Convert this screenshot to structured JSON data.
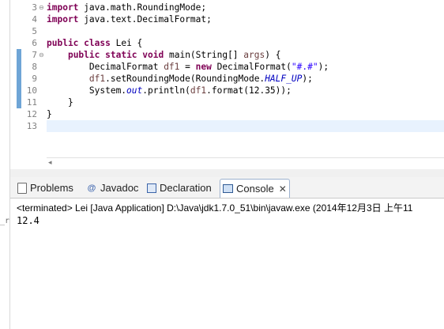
{
  "left_strip": {
    "fragment": "_r"
  },
  "editor": {
    "lines": [
      {
        "n": "3",
        "fold": "⊖"
      },
      {
        "n": "4"
      },
      {
        "n": "5"
      },
      {
        "n": "6"
      },
      {
        "n": "7",
        "fold": "⊖"
      },
      {
        "n": "8"
      },
      {
        "n": "9"
      },
      {
        "n": "10"
      },
      {
        "n": "11"
      },
      {
        "n": "12"
      },
      {
        "n": "13"
      }
    ],
    "code": {
      "l3_kw": "import",
      "l3_rest": " java.math.RoundingMode;",
      "l4_kw": "import",
      "l4_rest": " java.text.DecimalFormat;",
      "l6_kw1": "public",
      "l6_kw2": "class",
      "l6_rest": " Lei {",
      "l7_kw1": "public",
      "l7_kw2": "static",
      "l7_kw3": "void",
      "l7_mid": " main(String[] ",
      "l7_var": "args",
      "l7_end": ") {",
      "l8_a": "DecimalFormat ",
      "l8_var": "df1",
      "l8_b": " = ",
      "l8_kw": "new",
      "l8_c": " DecimalFormat(",
      "l8_str": "\"#.#\"",
      "l8_d": ");",
      "l9_var": "df1",
      "l9_a": ".setRoundingMode(RoundingMode.",
      "l9_fld": "HALF_UP",
      "l9_b": ");",
      "l10_a": "System.",
      "l10_fld": "out",
      "l10_b": ".println(",
      "l10_var": "df1",
      "l10_c": ".format(12.35));",
      "l11": "    }",
      "l12": "}"
    },
    "scroll_arrow": "◂"
  },
  "tabs": [
    {
      "label": "Problems",
      "icon": "problems-icon"
    },
    {
      "label": "Javadoc",
      "icon": "javadoc-icon",
      "glyph": "@"
    },
    {
      "label": "Declaration",
      "icon": "declaration-icon"
    },
    {
      "label": "Console",
      "icon": "console-icon",
      "close": "✕"
    }
  ],
  "console": {
    "status": "<terminated> Lei [Java Application] D:\\Java\\jdk1.7.0_51\\bin\\javaw.exe (2014年12月3日 上午11",
    "output": "12.4"
  },
  "colors": {
    "keyword": "#7f0055",
    "string": "#2a00ff",
    "static_field": "#0000c0",
    "local_var": "#6a3e3e",
    "current_line": "#e8f2fe",
    "change_marker": "#6fa5d6"
  }
}
